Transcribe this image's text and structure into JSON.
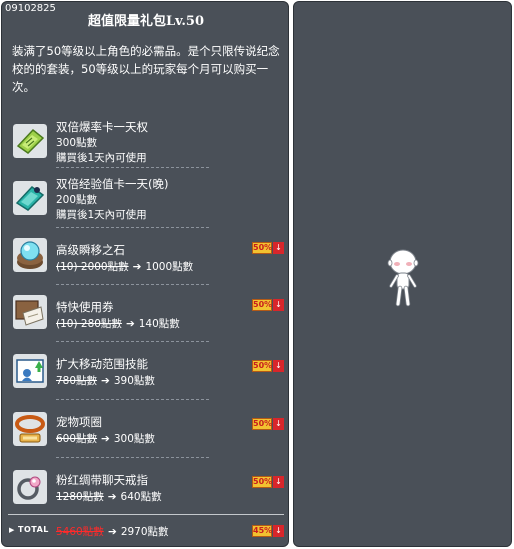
{
  "package": {
    "code": "09102825",
    "title": "超值限量礼包Lv.50",
    "description": "装满了50等级以上角色的必需品。是个只限传说纪念校的的套装，50等级以上的玩家每个月可以购买一次。"
  },
  "items": [
    {
      "name": "双倍爆率卡一天权",
      "line1": "300點數",
      "line2": "購買後1天內可使用",
      "icon": "double-drop-coupon-icon"
    },
    {
      "name": "双倍经验值卡一天(晚)",
      "line1": "200點數",
      "line2": "購買後1天內可使用",
      "icon": "double-exp-coupon-icon"
    },
    {
      "name": "高级瞬移之石",
      "old_price": "(10) 2000點數",
      "new_price": "1000點數",
      "badge": "50%",
      "icon": "teleport-rock-icon"
    },
    {
      "name": "特快使用券",
      "old_price": "(10) 280點數",
      "new_price": "140點數",
      "badge": "50%",
      "icon": "express-ticket-icon"
    },
    {
      "name": "扩大移动范围技能",
      "old_price": "780點數",
      "new_price": "390點數",
      "badge": "50%",
      "icon": "expand-movement-skill-icon"
    },
    {
      "name": "宠物项圈",
      "old_price": "600點數",
      "new_price": "300點數",
      "badge": "50%",
      "icon": "pet-collar-icon"
    },
    {
      "name": "粉红绸带聊天戒指",
      "old_price": "1280點數",
      "new_price": "640點數",
      "badge": "50%",
      "icon": "pink-ribbon-ring-icon"
    }
  ],
  "total": {
    "label": "TOTAL",
    "old_price": "5460點數",
    "new_price": "2970點數",
    "badge": "45%"
  },
  "arrow_glyph": "➔",
  "down_glyph": "↓",
  "colors": {
    "panel_bg": "#4a5058",
    "badge_bg": "#f2c230",
    "badge_text": "#c81e1e",
    "total_old": "#ff2a2a"
  }
}
